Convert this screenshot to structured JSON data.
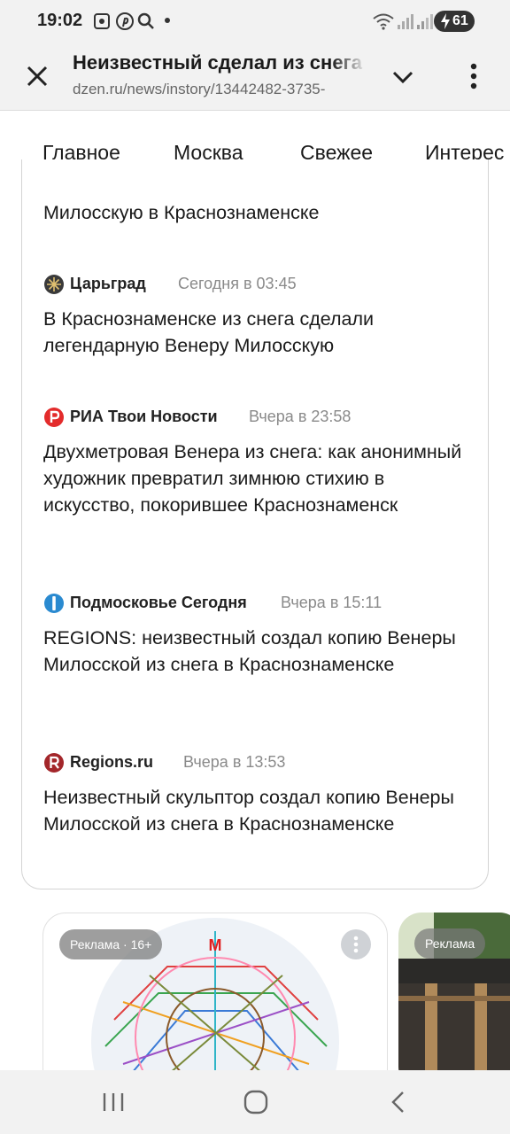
{
  "status": {
    "time": "19:02",
    "battery": "61",
    "icons": [
      "screenshot-icon",
      "pinterest-icon",
      "search-icon",
      "dot-icon",
      "wifi-icon",
      "signal-icon",
      "battery-icon"
    ]
  },
  "toolbar": {
    "title": "Неизвестный сделал из снега",
    "url": "dzen.ru/news/instory/13442482-3735-"
  },
  "tabs": [
    "Главное",
    "Москва",
    "Свежее",
    "Интерес"
  ],
  "articles": [
    {
      "headline": "Милосскую в Краснознаменске"
    },
    {
      "source": "Царьград",
      "time": "Сегодня в 03:45",
      "headline": "В Краснознаменске из снега сделали легендарную Венеру Милосскую"
    },
    {
      "source": "РИА Твои Новости",
      "time": "Вчера в 23:58",
      "headline": "Двухметровая Венера из снега: как анонимный художник превратил зимнюю стихию в искусство, покорившее Краснознаменск"
    },
    {
      "source": "Подмосковье Сегодня",
      "time": "Вчера в 15:11",
      "headline": "REGIONS: неизвестный создал копию Венеры Милосской из снега в Краснознаменске"
    },
    {
      "source": "Regions.ru",
      "time": "Вчера в 13:53",
      "headline": "Неизвестный скульптор создал копию Венеры Милосской из снега в Краснознаменске"
    }
  ],
  "ads": [
    {
      "badge": "Реклама · 16+",
      "logo": "М"
    },
    {
      "badge": "Реклама"
    }
  ],
  "colors": {
    "tsargrad": "#3a3a3a",
    "ria": "#e32b2b",
    "podmoskovye": "#2a8ad0",
    "regions": "#a3262a"
  }
}
